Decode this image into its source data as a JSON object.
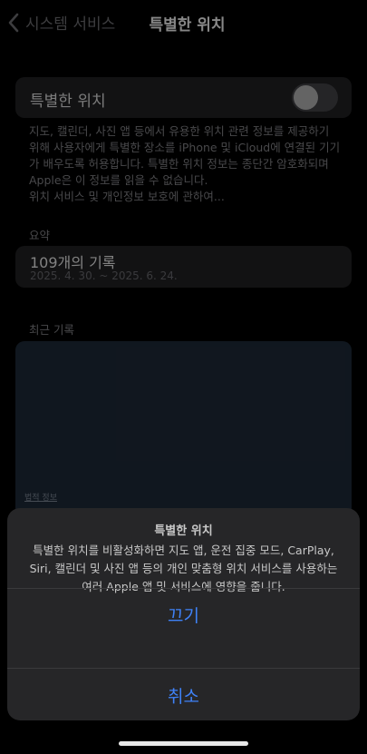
{
  "nav": {
    "back_label": "시스템 서비스",
    "title": "특별한 위치"
  },
  "toggle": {
    "label": "특별한 위치",
    "state": "off"
  },
  "description": {
    "text": "지도, 캘린더, 사진 앱 등에서 유용한 위치 관련 정보를 제공하기 위해 사용자에게 특별한 장소를 iPhone 및 iCloud에 연결된 기기가 배우도록 허용합니다. 특별한 위치 정보는 종단간 암호화되며 Apple은 이 정보를 읽을 수 없습니다.",
    "link": "위치 서비스 및 개인정보 보호에 관하여..."
  },
  "summary": {
    "header": "요약",
    "count": "109개의 기록",
    "range": "2025. 4. 30. ~ 2025. 6. 24."
  },
  "recent": {
    "header": "최근 기록",
    "legal_label": "법적 정보"
  },
  "alert": {
    "title": "특별한 위치",
    "message": "특별한 위치를 비활성화하면 지도 앱, 운전 집중 모드, CarPlay, Siri, 캘린더 및 사진 앱 등의 개인 맞춤형 위치 서비스를 사용하는 여러 Apple 앱 및 서비스에 영향을 줍니다.",
    "confirm_label": "끄기",
    "cancel_label": "취소"
  },
  "colors": {
    "accent": "#3f82f7",
    "sheet_bg": "#262628",
    "card_bg": "#1c1c1e"
  }
}
